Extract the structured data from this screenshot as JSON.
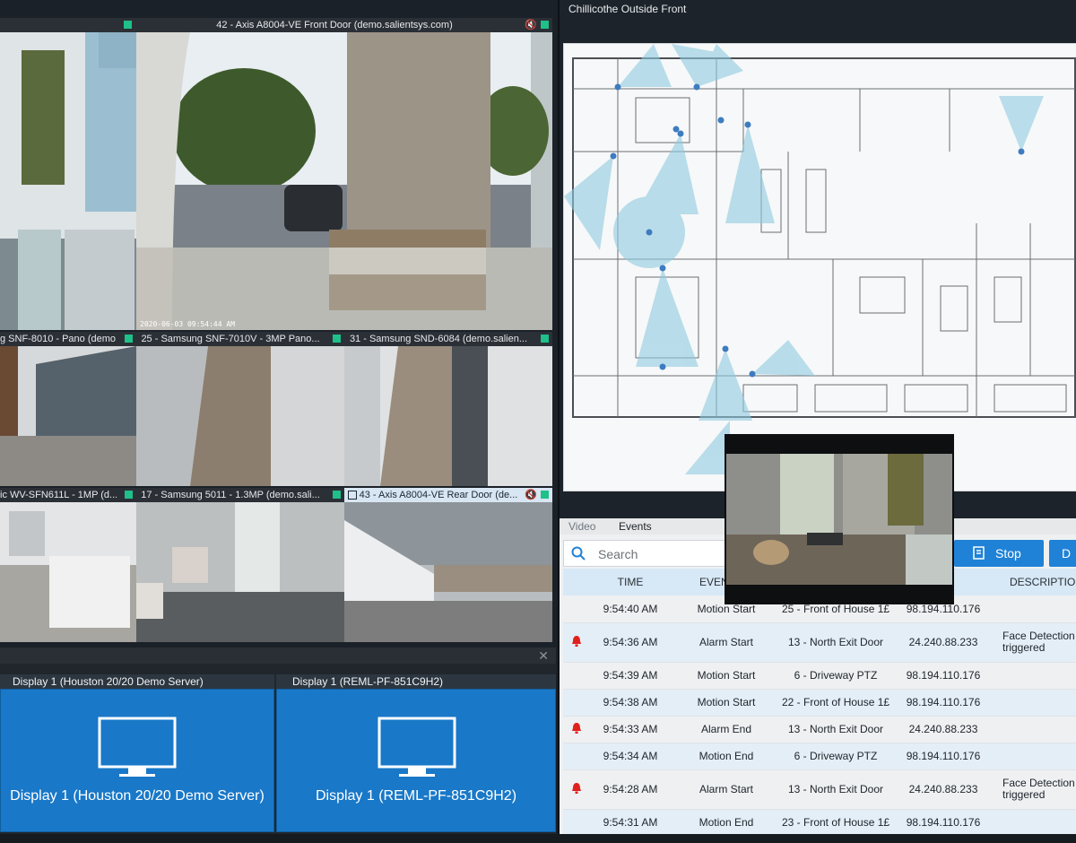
{
  "cameras": {
    "top_left": {
      "title": ""
    },
    "front_door": {
      "title": "42 - Axis A8004-VE Front Door (demo.salientsys.com)",
      "timestamp": "2020-06-03 09:54:44 AM"
    },
    "pano": {
      "title": "g SNF-8010 - Pano (demo..."
    },
    "snf7010": {
      "title": "25 - Samsung SNF-7010V - 3MP Pano..."
    },
    "snd6084": {
      "title": "31 - Samsung SND-6084 (demo.salien..."
    },
    "wv_sfn": {
      "title": "ic WV-SFN611L - 1MP (d..."
    },
    "s5011": {
      "title": "17 - Samsung 5011 - 1.3MP (demo.sali..."
    },
    "rear_door": {
      "title": "43 - Axis A8004-VE Rear Door (de..."
    }
  },
  "displays": [
    {
      "header": "Display 1 (Houston 20/20 Demo Server)",
      "label": "Display 1 (Houston 20/20 Demo Server)"
    },
    {
      "header": "Display 1 (REML-PF-851C9H2)",
      "label": "Display 1 (REML-PF-851C9H2)"
    }
  ],
  "map": {
    "title": "Chillicothe Outside Front"
  },
  "events": {
    "tabs": [
      "Video",
      "Events"
    ],
    "search_placeholder": "Search",
    "stop_label": "Stop",
    "next_label": "D",
    "columns": [
      "",
      "TIME",
      "EVENT",
      "",
      "",
      "DESCRIPTION"
    ],
    "rows": [
      {
        "alarm": false,
        "time": "9:54:40 AM",
        "event": "Motion Start",
        "source": "25 - Front of House 1£",
        "ip": "98.194.110.176",
        "desc": ""
      },
      {
        "alarm": true,
        "time": "9:54:36 AM",
        "event": "Alarm Start",
        "source": "13 - North Exit Door",
        "ip": "24.240.88.233",
        "desc": "Face Detection triggered"
      },
      {
        "alarm": false,
        "time": "9:54:39 AM",
        "event": "Motion Start",
        "source": "6 - Driveway PTZ",
        "ip": "98.194.110.176",
        "desc": ""
      },
      {
        "alarm": false,
        "time": "9:54:38 AM",
        "event": "Motion Start",
        "source": "22 - Front of House 1£",
        "ip": "98.194.110.176",
        "desc": ""
      },
      {
        "alarm": true,
        "time": "9:54:33 AM",
        "event": "Alarm End",
        "source": "13 - North Exit Door",
        "ip": "24.240.88.233",
        "desc": ""
      },
      {
        "alarm": false,
        "time": "9:54:34 AM",
        "event": "Motion End",
        "source": "6 - Driveway PTZ",
        "ip": "98.194.110.176",
        "desc": ""
      },
      {
        "alarm": true,
        "time": "9:54:28 AM",
        "event": "Alarm Start",
        "source": "13 - North Exit Door",
        "ip": "24.240.88.233",
        "desc": "Face Detection triggered"
      },
      {
        "alarm": false,
        "time": "9:54:31 AM",
        "event": "Motion End",
        "source": "23 - Front of House 1£",
        "ip": "98.194.110.176",
        "desc": ""
      }
    ]
  },
  "colors": {
    "accent": "#1f82d6",
    "status": "#1fc08a",
    "display_bg": "#1978c8",
    "alarm": "#e0201c",
    "header_highlight": "#d7e8f6"
  },
  "icons": {
    "status": "status-square",
    "mute": "speaker-mute-icon",
    "close": "close-icon",
    "search": "search-icon",
    "stop": "stop-icon",
    "display": "monitor-icon",
    "alarm": "bell-icon"
  }
}
